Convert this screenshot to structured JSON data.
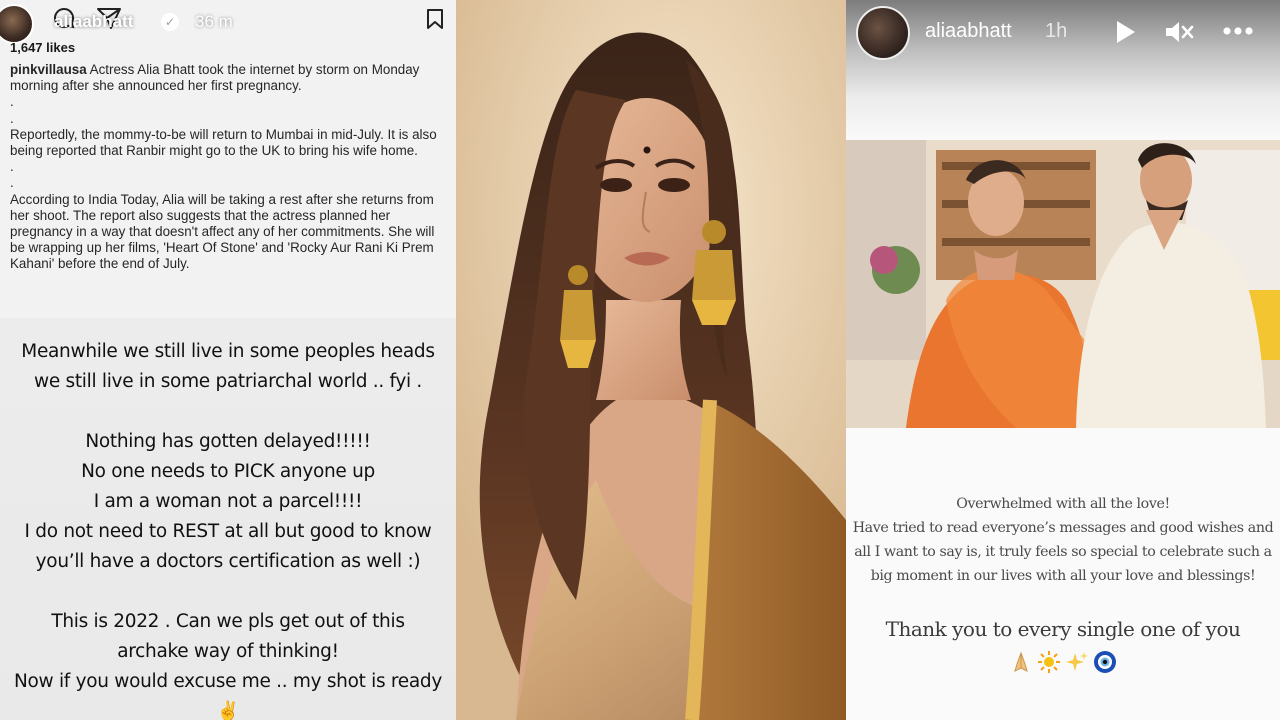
{
  "left_story": {
    "username": "aliaabhatt",
    "time": "36 m",
    "likes": "1,647 likes",
    "caption_handle": "pinkvillausa",
    "caption_paragraphs": [
      " Actress Alia Bhatt took the internet by storm on Monday morning after she announced her first pregnancy.",
      ".",
      ".",
      "Reportedly, the mommy-to-be will return to Mumbai in mid-July. It is also being reported that Ranbir might go to the UK to bring his wife home.",
      ".",
      ".",
      "According to India Today, Alia will be taking a rest after she returns from her shoot. The report also suggests that the actress planned her pregnancy in a way that doesn't affect any of her commitments. She will be wrapping up her films, 'Heart Of Stone' and 'Rocky Aur Rani Ki Prem Kahani' before the end of July."
    ],
    "note_lines": [
      "Meanwhile we still live in some peoples heads",
      "we still live in some patriarchal world .. fyi .",
      "",
      "Nothing has gotten delayed!!!!!",
      "No one needs to PICK anyone up",
      "I am a woman not a parcel!!!!",
      "I do not need to REST at all but good to know",
      "you’ll have a  doctors certification as well :)",
      "",
      "This is 2022 . Can we pls get out of this",
      "archake way of thinking!",
      "Now if you would excuse me .. my shot is ready",
      "✌️"
    ]
  },
  "right_story": {
    "username": "aliaabhatt",
    "time": "1h",
    "message_lines": [
      "Overwhelmed with all the love!",
      "Have tried to read everyone’s messages and good wishes and",
      "all I want to say is, it truly feels so special to celebrate such a",
      "big moment in our lives with all your love and blessings!"
    ],
    "thanks": "Thank you to every single one of you",
    "emojis": [
      "folded-hands",
      "sun",
      "sparkles",
      "nazar-amulet"
    ]
  }
}
